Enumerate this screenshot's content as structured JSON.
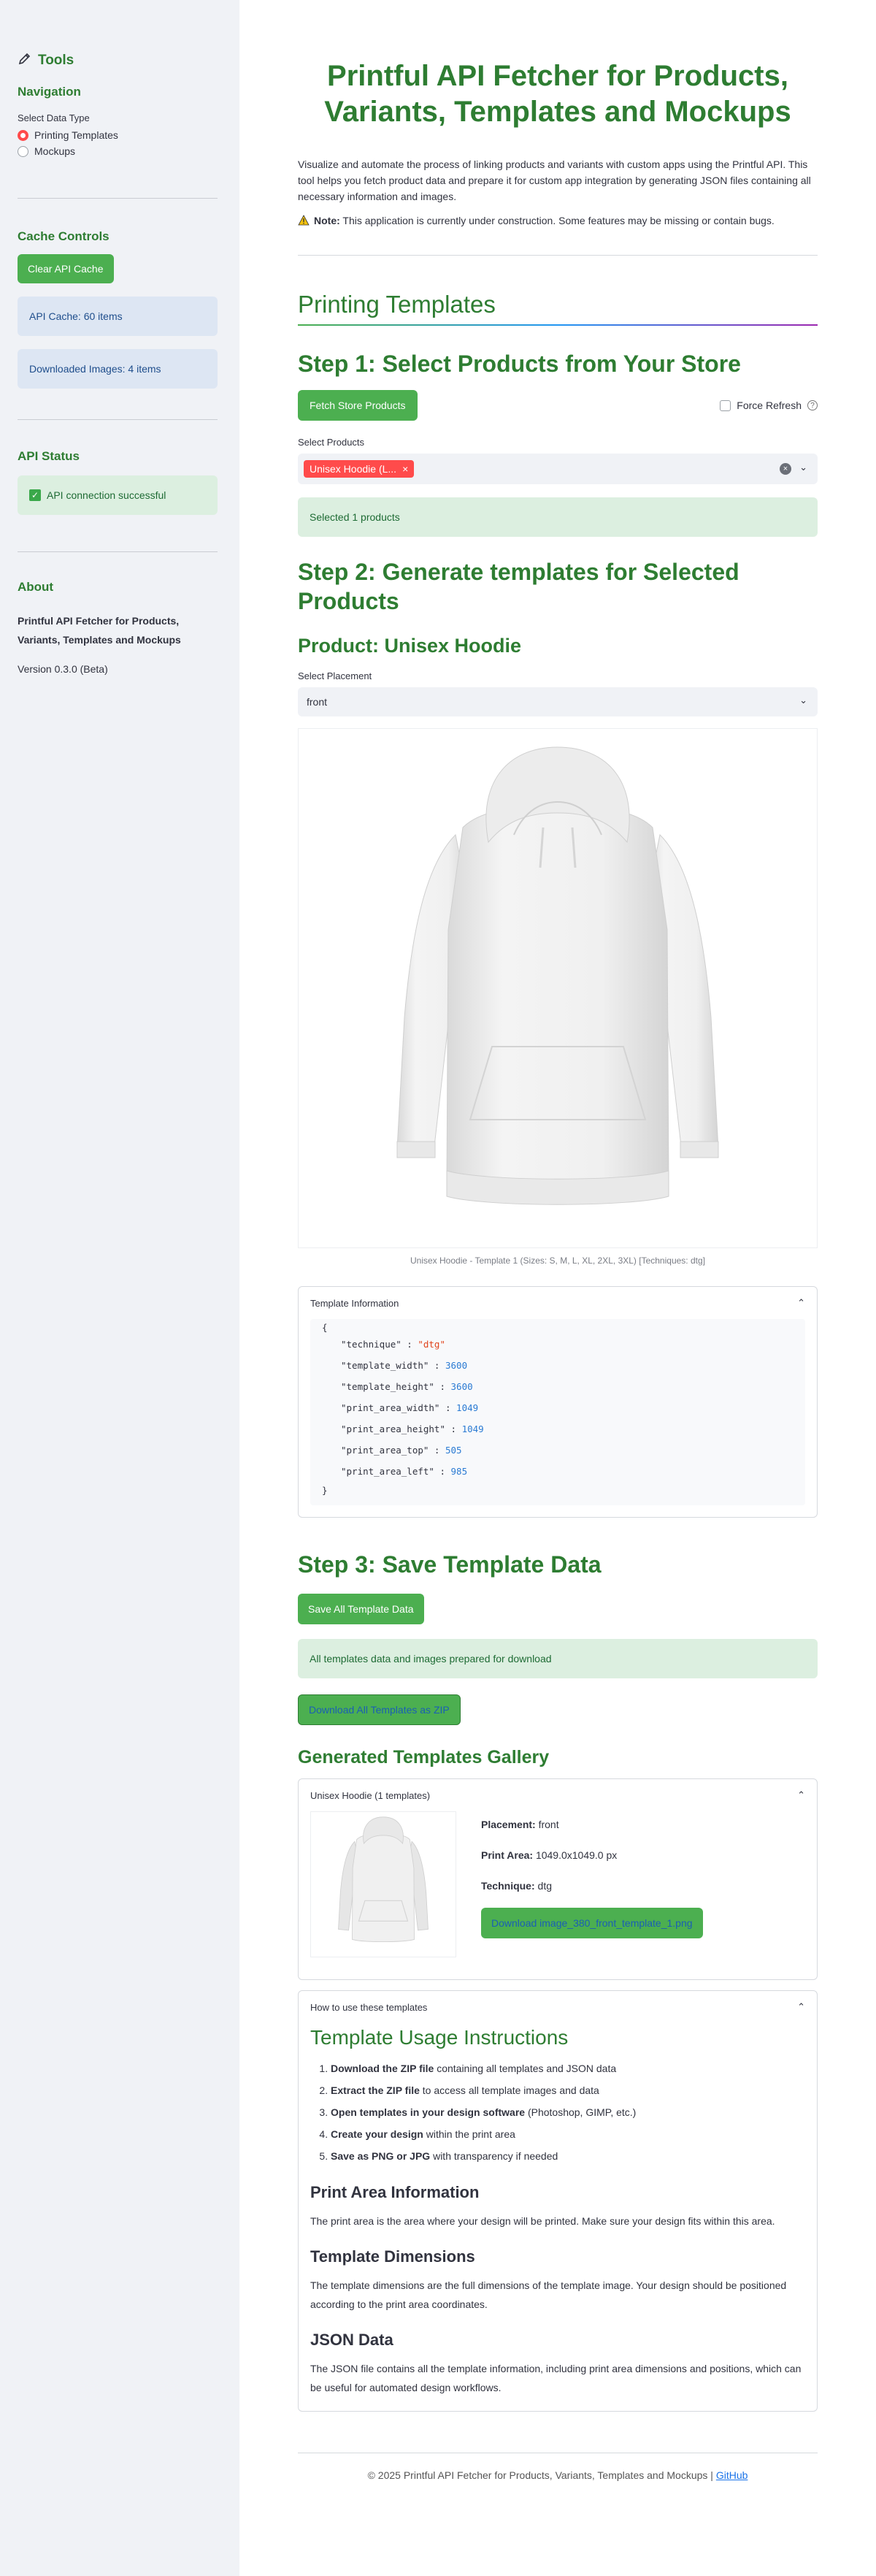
{
  "sidebar": {
    "tools_title": "Tools",
    "navigation_heading": "Navigation",
    "data_type_label": "Select Data Type",
    "data_type_options": [
      "Printing Templates",
      "Mockups"
    ],
    "cache_heading": "Cache Controls",
    "clear_cache_button": "Clear API Cache",
    "api_cache_info": "API Cache: 60 items",
    "downloaded_images_info": "Downloaded Images: 4 items",
    "api_status_heading": "API Status",
    "api_status_message": "API connection successful",
    "about_heading": "About",
    "about_text": "Printful API Fetcher for Products, Variants, Templates and Mockups",
    "version": "Version 0.3.0 (Beta)"
  },
  "main": {
    "title": "Printful API Fetcher for Products, Variants, Templates and Mockups",
    "intro": "Visualize and automate the process of linking products and variants with custom apps using the Printful API. This tool helps you fetch product data and prepare it for custom app integration by generating JSON files containing all necessary information and images.",
    "note_label": "Note:",
    "note_text": "This application is currently under construction. Some features may be missing or contain bugs.",
    "section_title": "Printing Templates",
    "step1_title": "Step 1: Select Products from Your Store",
    "fetch_button": "Fetch Store Products",
    "force_refresh_label": "Force Refresh",
    "select_products_label": "Select Products",
    "selected_chip": "Unisex Hoodie (L...",
    "selected_count": "Selected 1 products",
    "step2_title": "Step 2: Generate templates for Selected Products",
    "product_title": "Product: Unisex Hoodie",
    "placement_label": "Select Placement",
    "placement_value": "front",
    "image_caption": "Unisex Hoodie - Template 1 (Sizes: S, M, L, XL, 2XL, 3XL) [Techniques: dtg]",
    "template_info_label": "Template Information",
    "template_info": {
      "technique": "\"dtg\"",
      "template_width": "3600",
      "template_height": "3600",
      "print_area_width": "1049",
      "print_area_height": "1049",
      "print_area_top": "505",
      "print_area_left": "985"
    },
    "step3_title": "Step 3: Save Template Data",
    "save_button": "Save All Template Data",
    "prepared_message": "All templates data and images prepared for download",
    "download_zip_button": "Download All Templates as ZIP",
    "gallery_title": "Generated Templates Gallery",
    "gallery_expander": "Unisex Hoodie (1 templates)",
    "gallery_placement_label": "Placement:",
    "gallery_placement_value": "front",
    "gallery_area_label": "Print Area:",
    "gallery_area_value": "1049.0x1049.0 px",
    "gallery_technique_label": "Technique:",
    "gallery_technique_value": "dtg",
    "download_image_button": "Download image_380_front_template_1.png",
    "howto_expander": "How to use these templates",
    "usage_title": "Template Usage Instructions",
    "usage_steps": [
      {
        "bold": "Download the ZIP file",
        "rest": " containing all templates and JSON data"
      },
      {
        "bold": "Extract the ZIP file",
        "rest": " to access all template images and data"
      },
      {
        "bold": "Open templates in your design software",
        "rest": " (Photoshop, GIMP, etc.)"
      },
      {
        "bold": "Create your design",
        "rest": " within the print area"
      },
      {
        "bold": "Save as PNG or JPG",
        "rest": " with transparency if needed"
      }
    ],
    "print_area_title": "Print Area Information",
    "print_area_text": "The print area is the area where your design will be printed. Make sure your design fits within this area.",
    "dimensions_title": "Template Dimensions",
    "dimensions_text": "The template dimensions are the full dimensions of the template image. Your design should be positioned according to the print area coordinates.",
    "json_title": "JSON Data",
    "json_text": "The JSON file contains all the template information, including print area dimensions and positions, which can be useful for automated design workflows.",
    "footer_text": "© 2025 Printful API Fetcher for Products, Variants, Templates and Mockups |",
    "footer_link": "GitHub"
  },
  "colors": {
    "accent_green": "#2e7d32",
    "button_green": "#4caf50",
    "chip_red": "#ff4b4b"
  }
}
